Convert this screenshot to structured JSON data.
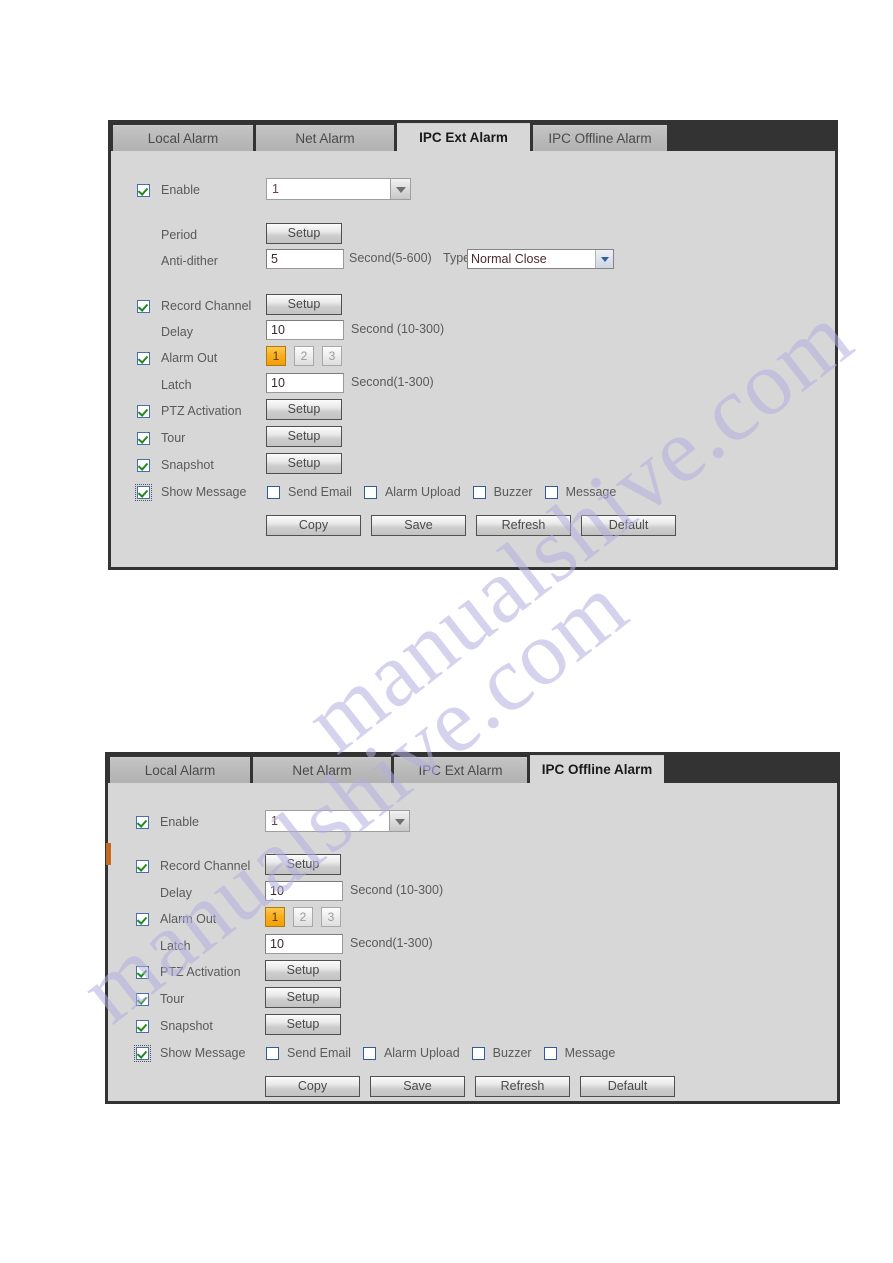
{
  "watermark": {
    "line1": "manualshive.com",
    "line2": "manualshive.com"
  },
  "tabs": {
    "local_alarm": "Local Alarm",
    "net_alarm": "Net Alarm",
    "ipc_ext_alarm": "IPC Ext Alarm",
    "ipc_offline_alarm": "IPC Offline Alarm"
  },
  "common": {
    "setup": "Setup",
    "copy": "Copy",
    "save": "Save",
    "refresh": "Refresh",
    "default": "Default",
    "enable": "Enable",
    "period": "Period",
    "anti_dither": "Anti-dither",
    "record_channel": "Record Channel",
    "delay": "Delay",
    "alarm_out": "Alarm Out",
    "latch": "Latch",
    "ptz_activation": "PTZ Activation",
    "tour": "Tour",
    "snapshot": "Snapshot",
    "show_message": "Show Message",
    "send_email": "Send Email",
    "alarm_upload": "Alarm Upload",
    "buzzer": "Buzzer",
    "message": "Message",
    "type_label": "Type",
    "hint_anti_dither": "Second(5-600)",
    "hint_delay": "Second (10-300)",
    "hint_latch": "Second(1-300)",
    "alarm_out_channels": [
      "1",
      "2",
      "3"
    ]
  },
  "panel_ext": {
    "active_tab": "IPC Ext Alarm",
    "enable_checked": true,
    "channel_value": "1",
    "anti_dither_value": "5",
    "type_value": "Normal Close",
    "record_channel_checked": true,
    "delay_value": "10",
    "alarm_out_checked": true,
    "alarm_out_selected": "1",
    "latch_value": "10",
    "ptz_activation_checked": true,
    "tour_checked": true,
    "snapshot_checked": true,
    "show_message_checked": true,
    "send_email_checked": false,
    "alarm_upload_checked": false,
    "buzzer_checked": false,
    "message_checked": false
  },
  "panel_offline": {
    "active_tab": "IPC Offline Alarm",
    "enable_checked": true,
    "channel_value": "1",
    "record_channel_checked": true,
    "delay_value": "10",
    "alarm_out_checked": true,
    "alarm_out_selected": "1",
    "latch_value": "10",
    "ptz_activation_checked": true,
    "tour_checked": true,
    "snapshot_checked": true,
    "show_message_checked": true,
    "send_email_checked": false,
    "alarm_upload_checked": false,
    "buzzer_checked": false,
    "message_checked": false
  },
  "colors": {
    "panel_bg": "#d7d7d7",
    "tab_bar": "#333333",
    "accent_orange": "#f9ad1f",
    "check_green": "#1d8a1d",
    "watermark": "#b3aee0"
  }
}
